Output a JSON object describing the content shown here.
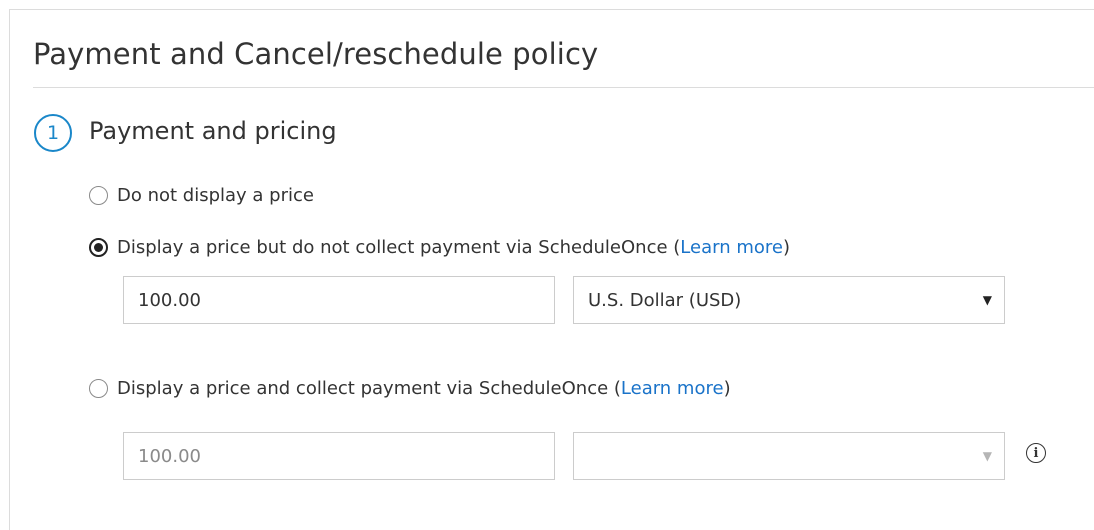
{
  "section": {
    "title": "Payment and Cancel/reschedule policy"
  },
  "step": {
    "number": "1",
    "title": "Payment and pricing"
  },
  "options": {
    "no_price": {
      "label": "Do not display a price",
      "selected": false
    },
    "display_only": {
      "label_before": "Display a price but do not collect payment via ScheduleOnce (",
      "link": "Learn more",
      "label_after": ")",
      "selected": true,
      "price_value": "100.00",
      "currency_value": "U.S. Dollar (USD)"
    },
    "collect": {
      "label_before": "Display a price and collect payment via ScheduleOnce (",
      "link": "Learn more",
      "label_after": ")",
      "selected": false,
      "price_value": "100.00",
      "currency_value": ""
    }
  },
  "icons": {
    "dropdown": "triangle-down",
    "info": "info-circle"
  },
  "colors": {
    "accent": "#1a87c9",
    "link": "#1a73c9",
    "text": "#333333",
    "border": "#cccccc"
  }
}
